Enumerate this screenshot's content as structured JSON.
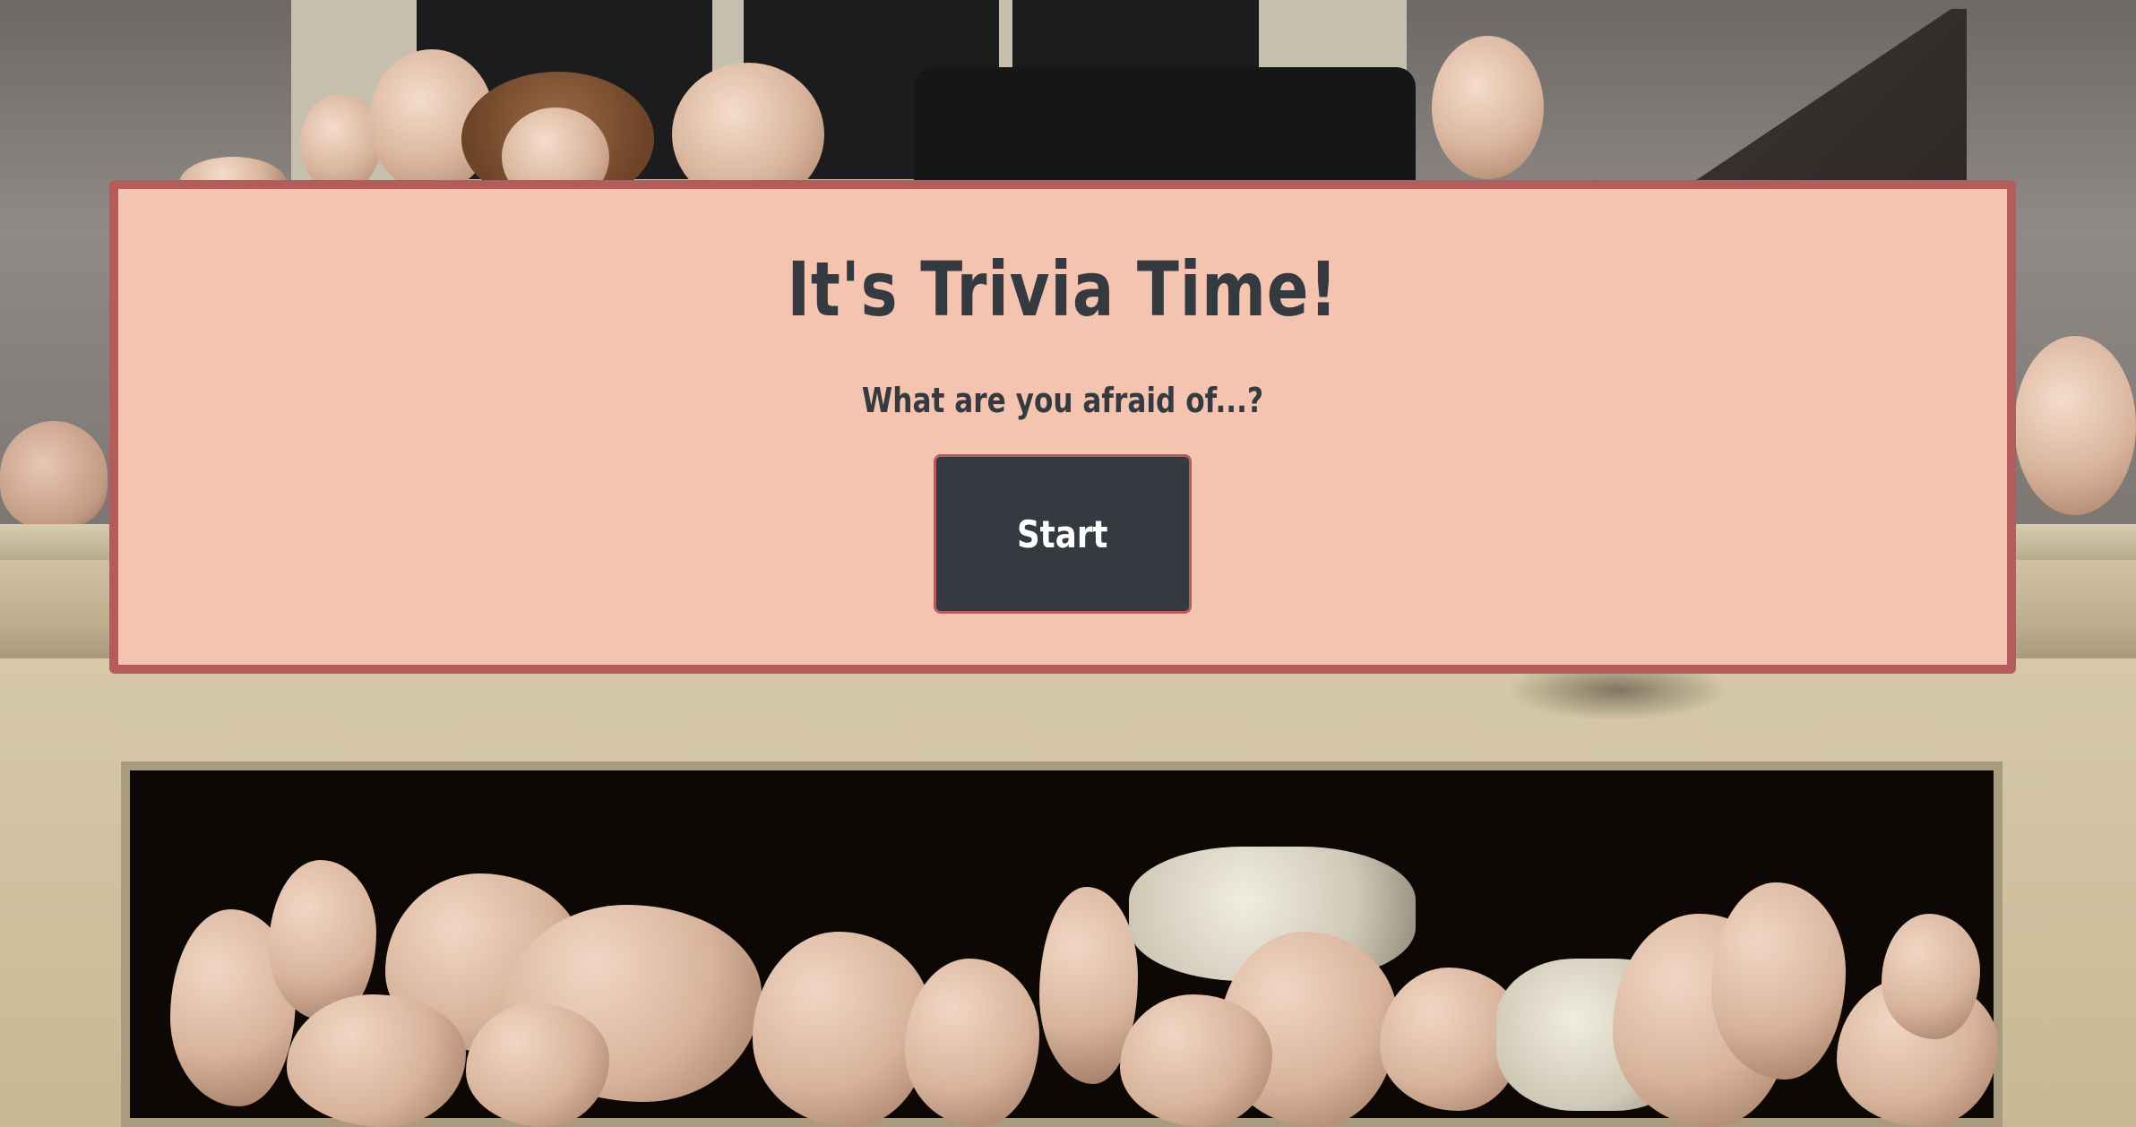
{
  "quiz": {
    "title": "It's Trivia Time!",
    "subtitle": "What are you afraid of...?",
    "start_label": "Start"
  },
  "colors": {
    "panel_background": "#f4c4b0",
    "panel_border": "#b45b5b",
    "text": "#343a40",
    "button_background": "#343a40",
    "button_text": "#ffffff"
  },
  "background": {
    "image_subject": "vintage doll heads on a mantel and doll bodies piled in a fireplace"
  }
}
